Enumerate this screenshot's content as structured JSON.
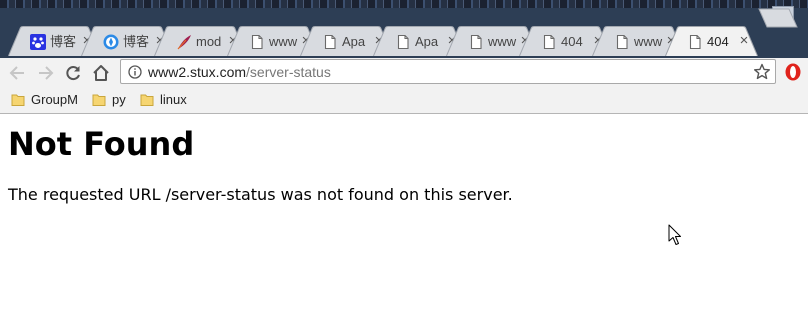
{
  "browser": {
    "tabs": [
      {
        "title": "博客",
        "favicon": "paw-icon",
        "active": false
      },
      {
        "title": "博客",
        "favicon": "compass-icon",
        "active": false
      },
      {
        "title": "mod",
        "favicon": "feather-icon",
        "active": false
      },
      {
        "title": "www",
        "favicon": "document-icon",
        "active": false
      },
      {
        "title": "Apa",
        "favicon": "document-icon",
        "active": false
      },
      {
        "title": "Apa",
        "favicon": "document-icon",
        "active": false
      },
      {
        "title": "www",
        "favicon": "document-icon",
        "active": false
      },
      {
        "title": "404",
        "favicon": "document-icon",
        "active": false
      },
      {
        "title": "www",
        "favicon": "document-icon",
        "active": false
      },
      {
        "title": "404",
        "favicon": "document-icon",
        "active": true
      }
    ],
    "tab_close_glyph": "×",
    "address_bar": {
      "host": "www2.stux.com",
      "path": "/server-status"
    },
    "bookmarks": [
      {
        "label": "GroupM",
        "icon": "folder-icon"
      },
      {
        "label": "py",
        "icon": "folder-icon"
      },
      {
        "label": "linux",
        "icon": "folder-icon"
      }
    ],
    "accent_colors": {
      "titlebar": "#2d3e55",
      "toolbar": "#f2f2f2",
      "extension_red": "#e0231c"
    }
  },
  "page": {
    "heading": "Not Found",
    "message": "The requested URL /server-status was not found on this server."
  }
}
